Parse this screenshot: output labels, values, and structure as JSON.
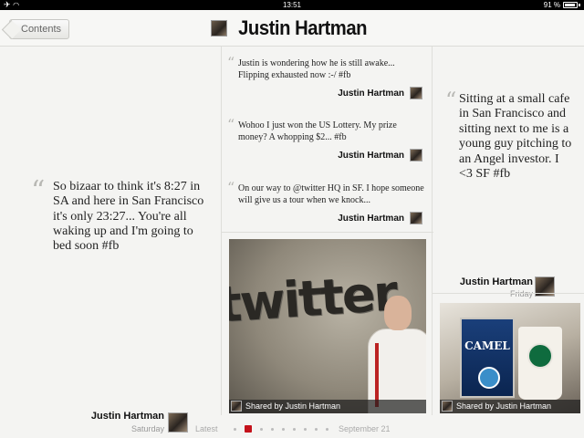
{
  "status_bar": {
    "time": "13:51",
    "battery": "91 %"
  },
  "header": {
    "back_label": "Contents",
    "title": "Justin Hartman"
  },
  "tweets": {
    "left": {
      "text": "So bizaar to think it's 8:27 in SA and here in San Francisco it's only 23:27... You're all waking up and I'm going to bed soon #fb",
      "author": "Justin Hartman",
      "time": "Saturday"
    },
    "mid": [
      {
        "text": "Justin is wondering how he is still awake... Flipping exhausted now :-/ #fb",
        "author": "Justin Hartman"
      },
      {
        "text": "Wohoo I just won the US Lottery. My prize money? A whopping $2... #fb",
        "author": "Justin Hartman"
      },
      {
        "text": "On our way to @twitter HQ in SF. I hope someone will give us a tour when we knock...",
        "author": "Justin Hartman"
      }
    ],
    "right": {
      "text": "Sitting at a small cafe in San Francisco and sitting next to me is a young guy pitching to an Angel investor. I <3 SF #fb",
      "author": "Justin Hartman",
      "time": "Friday"
    }
  },
  "photos": {
    "mid": {
      "caption": "Shared by Justin Hartman",
      "scene_text": "twitter"
    },
    "right": {
      "caption": "Shared by Justin Hartman",
      "scene_text": "CAMEL"
    }
  },
  "pager": {
    "left_label": "Latest",
    "right_label": "September 21",
    "page_count": 9,
    "active_index": 1
  },
  "icons": {
    "airplane": "airplane-icon",
    "wifi": "wifi-icon",
    "battery": "battery-icon"
  },
  "colors": {
    "accent": "#c4121b",
    "background": "#f4f4f2"
  }
}
